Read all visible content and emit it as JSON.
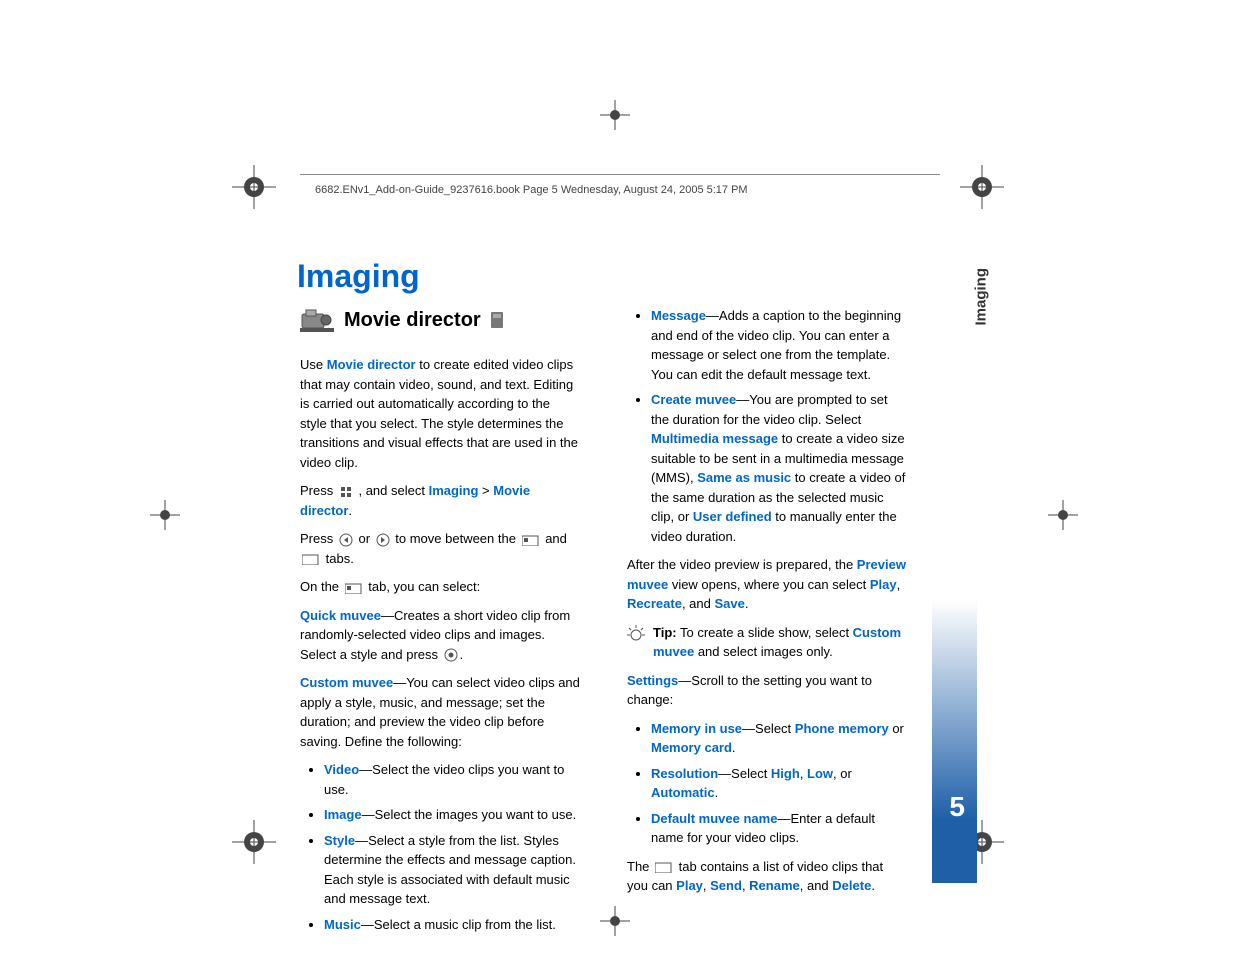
{
  "header": "6682.ENv1_Add-on-Guide_9237616.book  Page 5  Wednesday, August 24, 2005  5:17 PM",
  "title": "Imaging",
  "section": "Movie director",
  "sideLabel": "Imaging",
  "pageNumber": "5",
  "left": {
    "p1a": "Use ",
    "p1b": "Movie director",
    "p1c": " to create edited video clips that may contain video, sound, and text. Editing is carried out automatically according to the style that you select. The style determines the transitions and visual effects that are used in the video clip.",
    "p2a": "Press ",
    "p2b": ", and select ",
    "p2c": "Imaging",
    "p2d": " > ",
    "p2e": "Movie director",
    "p2f": ".",
    "p3a": "Press ",
    "p3b": " or ",
    "p3c": " to move between the ",
    "p3d": " and ",
    "p3e": " tabs.",
    "p4a": "On the ",
    "p4b": " tab, you can select:",
    "qm": "Quick muvee",
    "qm_t": "—Creates a short video clip from randomly-selected video clips and images. Select a style and press ",
    "qm_t2": ".",
    "cm": "Custom muvee",
    "cm_t": "—You can select video clips and apply a style, music, and message; set the duration; and preview the video clip before saving. Define the following:",
    "li_video": "Video",
    "li_video_t": "—Select the video clips you want to use.",
    "li_image": "Image",
    "li_image_t": "—Select the images you want to use.",
    "li_style": "Style",
    "li_style_t": "—Select a style from the list. Styles determine the effects and message caption. Each style is associated with default music and message text.",
    "li_music": "Music",
    "li_music_t": "—Select a music clip from the list."
  },
  "right": {
    "li_msg": "Message",
    "li_msg_t": "—Adds a caption to the beginning and end of the video clip. You can enter a message or select one from the template. You can edit the default message text.",
    "li_cm": "Create muvee",
    "li_cm_t1": "—You are prompted to set the duration for the video clip. Select ",
    "li_cm_mm": "Multimedia message",
    "li_cm_t2": " to create a video size suitable to be sent in a multimedia message (MMS), ",
    "li_cm_sam": "Same as music",
    "li_cm_t3": " to create a video of the same duration as the selected music clip, or ",
    "li_cm_ud": "User defined",
    "li_cm_t4": " to manually enter the video duration.",
    "p5a": "After the video preview is prepared, the ",
    "p5b": "Preview muvee",
    "p5c": " view opens, where you can select ",
    "p5_play": "Play",
    "p5_comma1": ", ",
    "p5_rec": "Recreate",
    "p5_comma2": ", and ",
    "p5_save": "Save",
    "p5_end": ".",
    "tip_label": "Tip:",
    "tip_t1": " To create a slide show, select ",
    "tip_cm": "Custom muvee",
    "tip_t2": " and select images only.",
    "settings": "Settings",
    "settings_t": "—Scroll to the setting you want to change:",
    "li_mem": "Memory in use",
    "li_mem_t1": "—Select ",
    "li_mem_pm": "Phone memory",
    "li_mem_or": " or ",
    "li_mem_mc": "Memory card",
    "li_mem_end": ".",
    "li_res": "Resolution",
    "li_res_t1": "—Select ",
    "li_res_h": "High",
    "li_res_c1": ", ",
    "li_res_l": "Low",
    "li_res_c2": ", or ",
    "li_res_a": "Automatic",
    "li_res_end": ".",
    "li_dmn": "Default muvee name",
    "li_dmn_t": "—Enter a default name for your video clips.",
    "p6a": "The ",
    "p6b": " tab contains a list of video clips that you can ",
    "p6_play": "Play",
    "p6_c1": ", ",
    "p6_send": "Send",
    "p6_c2": ", ",
    "p6_ren": "Rename",
    "p6_c3": ", and ",
    "p6_del": "Delete",
    "p6_end": "."
  }
}
